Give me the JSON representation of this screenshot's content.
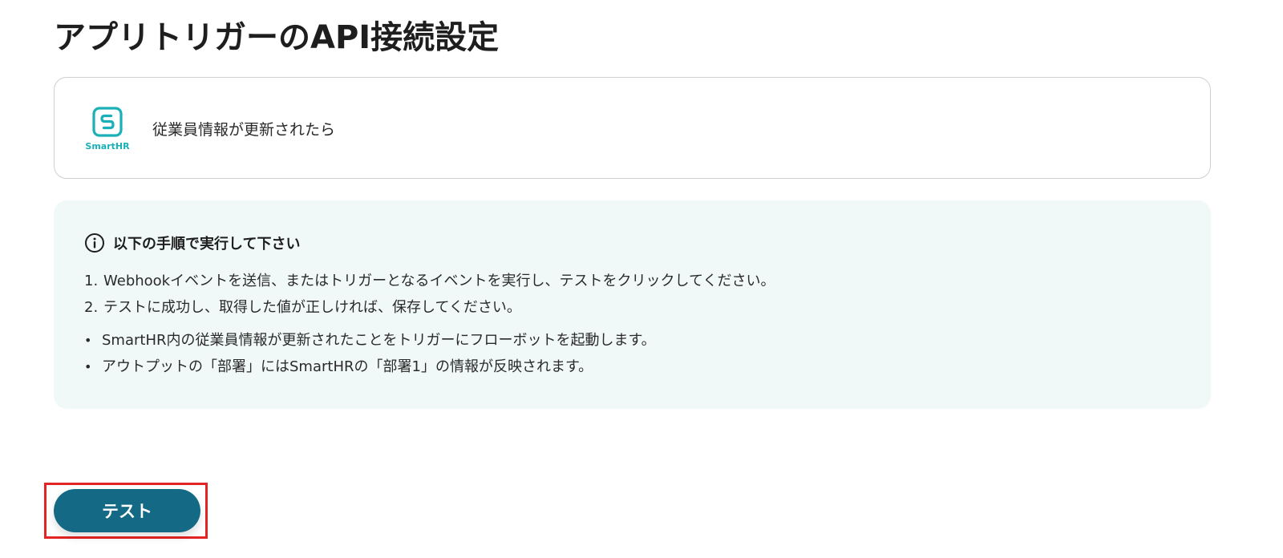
{
  "page": {
    "title": "アプリトリガーのAPI接続設定"
  },
  "app_card": {
    "app_name": "SmartHR",
    "logo_icon": "smarthr-logo-icon",
    "trigger_name": "従業員情報が更新されたら"
  },
  "instructions": {
    "icon": "info-icon",
    "title": "以下の手順で実行して下さい",
    "steps": [
      {
        "num": "1.",
        "text": "Webhookイベントを送信、またはトリガーとなるイベントを実行し、テストをクリックしてください。"
      },
      {
        "num": "2.",
        "text": "テストに成功し、取得した値が正しければ、保存してください。"
      }
    ],
    "notes": [
      {
        "bullet": "•",
        "text": "SmartHR内の従業員情報が更新されたことをトリガーにフローボットを起動します。"
      },
      {
        "bullet": "•",
        "text": "アウトプットの「部署」にはSmartHRの「部署1」の情報が反映されます。"
      }
    ]
  },
  "actions": {
    "test_label": "テスト"
  },
  "colors": {
    "brand_teal": "#1ab0b8",
    "button_bg": "#146a84",
    "info_bg": "#f1f9f8",
    "highlight": "#e32424"
  }
}
